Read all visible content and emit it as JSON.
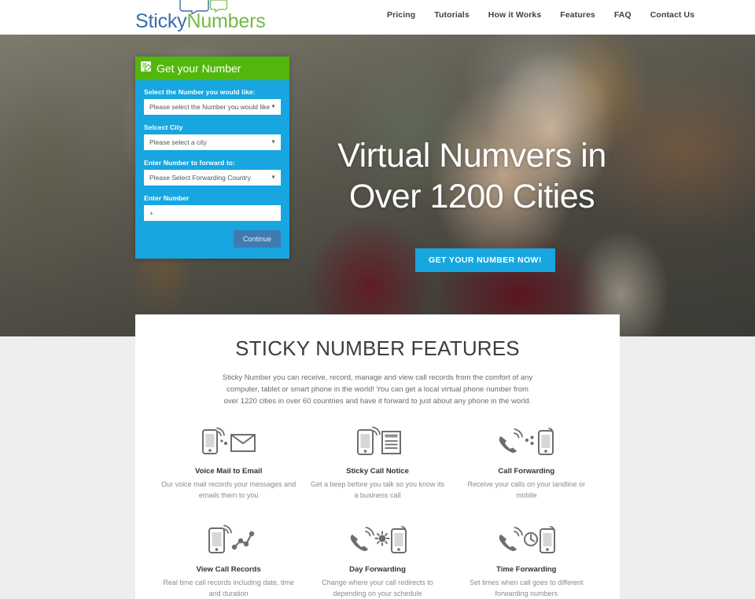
{
  "header": {
    "logo": {
      "part1": "Sticky",
      "part2": "Numbers",
      "icon": "speech-bubbles-icon"
    },
    "nav": [
      {
        "label": "Pricing"
      },
      {
        "label": "Tutorials"
      },
      {
        "label": "How it Works"
      },
      {
        "label": "Features"
      },
      {
        "label": "FAQ"
      },
      {
        "label": "Contact Us"
      }
    ]
  },
  "hero": {
    "headline_line1": "Virtual Numvers in",
    "headline_line2": "Over 1200 Cities",
    "cta_label": "GET YOUR NUMBER NOW!"
  },
  "form": {
    "title": "Get your Number",
    "title_icon": "form-pencil-icon",
    "fields": [
      {
        "label": "Select the Number you would like:",
        "type": "select",
        "value": "Please select the Number you would like"
      },
      {
        "label": "Selcect City",
        "type": "select",
        "value": "Please select a city"
      },
      {
        "label": "Enter Number to forward to:",
        "type": "select",
        "value": "Please Select Forwarding Country"
      },
      {
        "label": "Enter Number",
        "type": "text",
        "value": "+",
        "placeholder": "+"
      }
    ],
    "submit_label": "Continue"
  },
  "features_section": {
    "title": "STICKY NUMBER FEATURES",
    "intro": "Sticky Number you can receive, record, manage and view call records from the comfort of any computer, tablet or smart phone in the world! You can get a local virtual phone number from over 1220 cities in over 60 countries and have it forward to just about any phone in the world.",
    "items": [
      {
        "icon": "phone-to-envelope-icon",
        "title": "Voice Mail to Email",
        "desc": "Our voice mail records your messages and emails them to you"
      },
      {
        "icon": "phone-to-document-icon",
        "title": "Sticky Call Notice",
        "desc": "Get a beep before you talk so you know its a business call"
      },
      {
        "icon": "handset-to-phone-icon",
        "title": "Call Forwarding",
        "desc": "Receive your calls on your landline or mobile"
      },
      {
        "icon": "phone-to-chart-icon",
        "title": "View Call Records",
        "desc": "Real time call records including date, time and duration"
      },
      {
        "icon": "handset-sun-phone-icon",
        "title": "Day Forwarding",
        "desc": "Change where your call redirects to depending on your schedule"
      },
      {
        "icon": "handset-clock-phone-icon",
        "title": "Time Forwarding",
        "desc": "Set times when call goes to different forwarding numbers"
      }
    ]
  },
  "colors": {
    "brand_blue": "#17a6e0",
    "brand_green": "#52b70c",
    "logo_blue": "#3a6cb0",
    "logo_green": "#76b946",
    "continue_blue": "#3f7bb0",
    "page_bg": "#eceef0"
  }
}
